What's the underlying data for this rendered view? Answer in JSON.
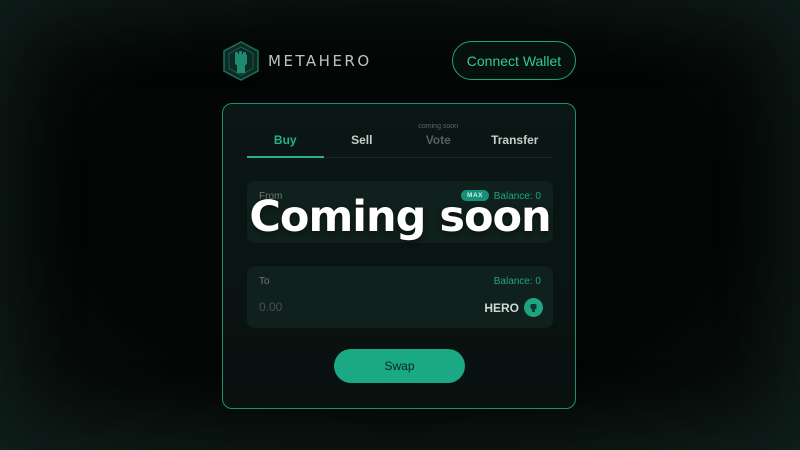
{
  "header": {
    "brand_name": "METAHERO",
    "logo_icon": "metahero-shield-icon",
    "connect_wallet_label": "Connect Wallet"
  },
  "tabs": [
    {
      "label": "Buy",
      "note": "",
      "state": "active"
    },
    {
      "label": "Sell",
      "note": "",
      "state": "normal"
    },
    {
      "label": "Vote",
      "note": "coming soon",
      "state": "disabled"
    },
    {
      "label": "Transfer",
      "note": "",
      "state": "normal"
    }
  ],
  "from": {
    "label": "From",
    "max_label": "MAX",
    "balance": "Balance: 0"
  },
  "to": {
    "label": "To",
    "balance": "Balance: 0",
    "amount_placeholder": "0.00",
    "token_symbol": "HERO",
    "token_icon": "hero-token-icon"
  },
  "swap_label": "Swap",
  "overlay_text": "Coming soon",
  "colors": {
    "accent": "#1fa482",
    "background": "#030504",
    "card": "#0b1715"
  }
}
